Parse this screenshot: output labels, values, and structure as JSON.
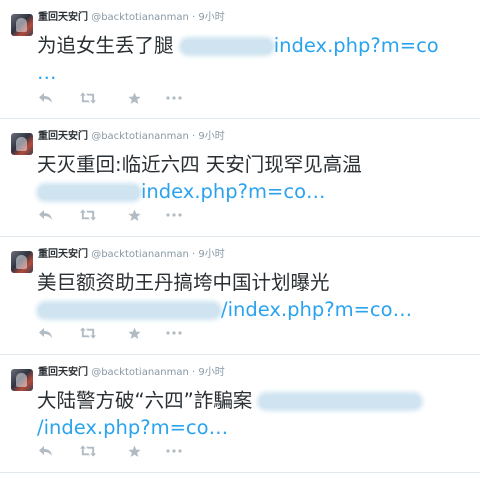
{
  "tweets": [
    {
      "name": "重回天安门",
      "handle": "@backtotiananman",
      "time": "· 9小时",
      "text": "为追女生丢了腿",
      "link": "index.php?m=co",
      "link_tail": "…"
    },
    {
      "name": "重回天安门",
      "handle": "@backtotiananman",
      "time": "· 9小时",
      "text": "天灭重回:临近六四 天安门现罕见高温",
      "link": "index.php?m=co…"
    },
    {
      "name": "重回天安门",
      "handle": "@backtotiananman",
      "time": "· 9小时",
      "text": "美巨额资助王丹搞垮中国计划曝光",
      "link": "/index.php?m=co…"
    },
    {
      "name": "重回天安门",
      "handle": "@backtotiananman",
      "time": "· 9小时",
      "text": "大陆警方破“六四”詐騙案",
      "link": "/index.php?m=co…"
    }
  ],
  "icons": {
    "reply": "reply-icon",
    "retweet": "retweet-icon",
    "favorite": "star-icon",
    "more": "more-icon"
  },
  "colors": {
    "link": "#2aa3ef",
    "text": "#292f33",
    "meta": "#8899a6",
    "action_icon": "#b1bbc3"
  }
}
